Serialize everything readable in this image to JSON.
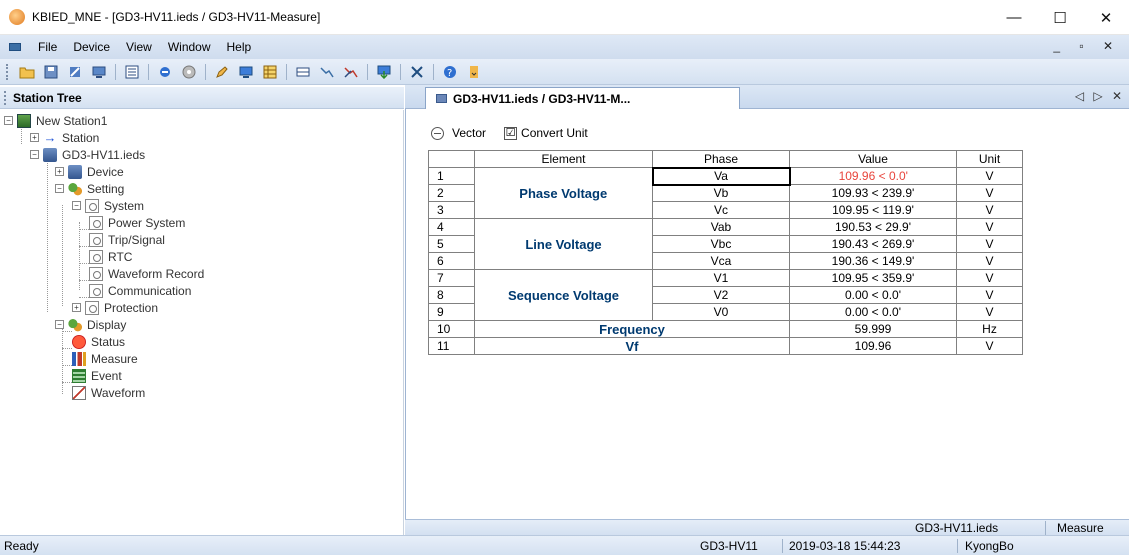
{
  "window": {
    "title": "KBIED_MNE - [GD3-HV11.ieds / GD3-HV11-Measure]",
    "min": "—",
    "max": "☐",
    "close": "✕"
  },
  "menu": {
    "items": [
      "File",
      "Device",
      "View",
      "Window",
      "Help"
    ],
    "mdi_controls": "_ ▫ ✕"
  },
  "toolbar": {
    "icons": [
      "open-folder-icon",
      "save-icon",
      "tools-icon",
      "network-icon",
      "list-icon",
      "connect-icon",
      "disk-icon",
      "edit-icon",
      "monitor-icon",
      "table-icon",
      "grid-icon",
      "line-icon",
      "line-red-icon",
      "export-icon",
      "delete-icon",
      "help-icon",
      "dropdown-icon"
    ]
  },
  "left_panel": {
    "title": "Station Tree",
    "tree": [
      {
        "label": "New Station1",
        "icon": "station-icon"
      },
      {
        "label": "Station",
        "icon": "arrow-icon"
      },
      {
        "label": "GD3-HV11.ieds",
        "icon": "device-icon"
      },
      {
        "label": "Device",
        "icon": "device-icon"
      },
      {
        "label": "Setting",
        "icon": "gear-icon"
      },
      {
        "label": "System",
        "icon": "page-icon"
      },
      {
        "label": "Power System",
        "icon": "page-icon"
      },
      {
        "label": "Trip/Signal",
        "icon": "page-icon"
      },
      {
        "label": "RTC",
        "icon": "page-icon"
      },
      {
        "label": "Waveform Record",
        "icon": "page-icon"
      },
      {
        "label": "Communication",
        "icon": "page-icon"
      },
      {
        "label": "Protection",
        "icon": "page-icon"
      },
      {
        "label": "Display",
        "icon": "gear-icon"
      },
      {
        "label": "Status",
        "icon": "status-icon"
      },
      {
        "label": "Measure",
        "icon": "measure-icon"
      },
      {
        "label": "Event",
        "icon": "event-icon"
      },
      {
        "label": "Waveform",
        "icon": "waveform-icon"
      }
    ]
  },
  "doc": {
    "tab_label": "GD3-HV11.ieds / GD3-HV11-M...",
    "tab_nav": "◁ ▷ ✕",
    "vector_label": "Vector",
    "convert_unit_label": "Convert Unit",
    "convert_unit_checked": "☑",
    "columns": [
      "Element",
      "Phase",
      "Value",
      "Unit"
    ],
    "groups": {
      "phase_voltage": "Phase Voltage",
      "line_voltage": "Line Voltage",
      "sequence_voltage": "Sequence Voltage",
      "frequency": "Frequency",
      "vf": "Vf"
    },
    "rows": [
      {
        "n": "1",
        "phase": "Va",
        "value": "109.96 < 0.0'",
        "unit": "V"
      },
      {
        "n": "2",
        "phase": "Vb",
        "value": "109.93 < 239.9'",
        "unit": "V"
      },
      {
        "n": "3",
        "phase": "Vc",
        "value": "109.95 < 119.9'",
        "unit": "V"
      },
      {
        "n": "4",
        "phase": "Vab",
        "value": "190.53 < 29.9'",
        "unit": "V"
      },
      {
        "n": "5",
        "phase": "Vbc",
        "value": "190.43 < 269.9'",
        "unit": "V"
      },
      {
        "n": "6",
        "phase": "Vca",
        "value": "190.36 < 149.9'",
        "unit": "V"
      },
      {
        "n": "7",
        "phase": "V1",
        "value": "109.95 < 359.9'",
        "unit": "V"
      },
      {
        "n": "8",
        "phase": "V2",
        "value": "0.00 < 0.0'",
        "unit": "V"
      },
      {
        "n": "9",
        "phase": "V0",
        "value": "0.00 < 0.0'",
        "unit": "V"
      },
      {
        "n": "10",
        "phase": "",
        "value": "59.999",
        "unit": "Hz"
      },
      {
        "n": "11",
        "phase": "",
        "value": "109.96",
        "unit": "V"
      }
    ],
    "status_file": "GD3-HV11.ieds",
    "status_view": "Measure"
  },
  "statusbar": {
    "ready": "Ready",
    "device": "GD3-HV11",
    "datetime": "2019-03-18 15:44:23",
    "user": "KyongBo"
  },
  "colors": {
    "accent_red": "#e8453c",
    "element_blue": "#003a70"
  }
}
